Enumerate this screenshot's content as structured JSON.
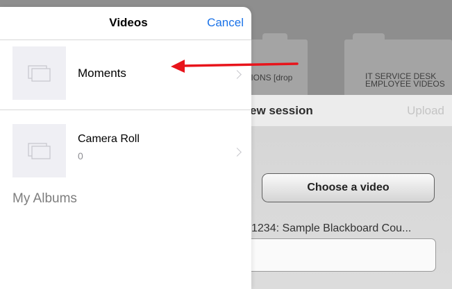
{
  "background": {
    "folders": [
      {
        "label": "TIONS [drop"
      },
      {
        "label": "IT SERVICE DESK EMPLOYEE VIDEOS"
      }
    ],
    "session": {
      "title": "ew session",
      "upload_label": "Upload",
      "choose_label": "Choose a video",
      "course_text": "1234: Sample Blackboard Cou..."
    }
  },
  "popover": {
    "title": "Videos",
    "cancel_label": "Cancel",
    "albums": [
      {
        "name": "Moments",
        "icon": "album-stack-icon"
      },
      {
        "name": "Camera Roll",
        "count": "0",
        "icon": "album-stack-icon"
      }
    ],
    "section_label": "My Albums"
  },
  "annotation": {
    "arrow_color": "#e8141b",
    "icon": "annotation-arrow-icon"
  },
  "colors": {
    "accent": "#1a72e8",
    "chevron": "#c7c7cc"
  }
}
